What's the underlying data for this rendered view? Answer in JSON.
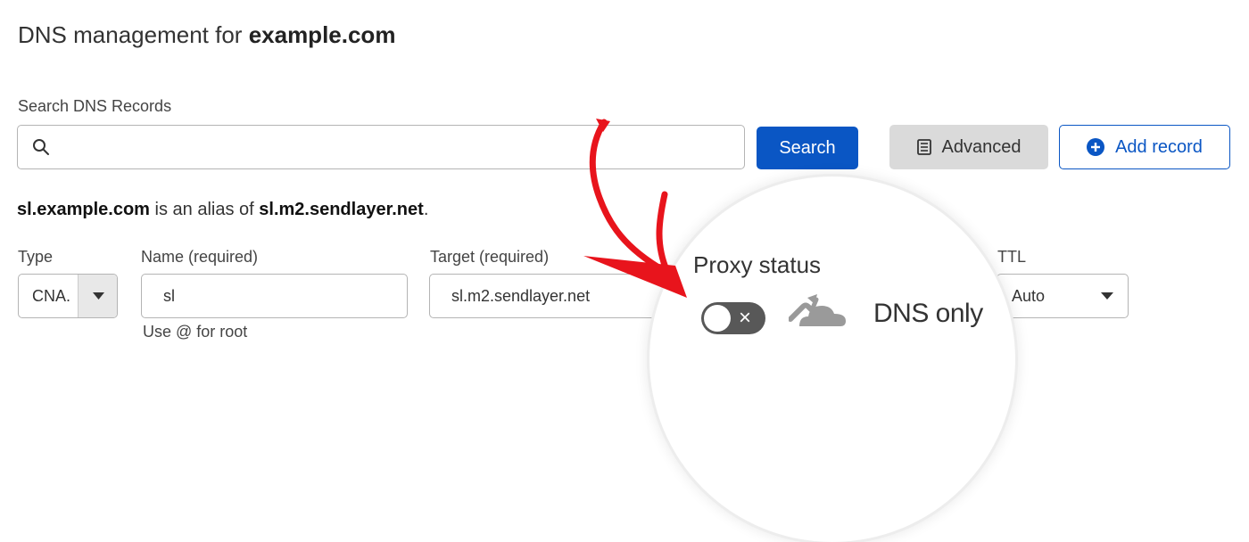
{
  "header": {
    "title_prefix": "DNS management for",
    "domain": "example.com"
  },
  "search": {
    "label": "Search DNS Records",
    "value": "",
    "placeholder": "",
    "button_label": "Search"
  },
  "toolbar": {
    "advanced_label": "Advanced",
    "add_record_label": "Add record"
  },
  "alias_note": {
    "host": "sl.example.com",
    "middle": "is an alias of",
    "target": "sl.m2.sendlayer.net",
    "end": "."
  },
  "record_form": {
    "type_label": "Type",
    "type_value": "CNA.",
    "name_label": "Name (required)",
    "name_value": "sl",
    "name_hint": "Use @ for root",
    "target_label": "Target (required)",
    "target_value": "sl.m2.sendlayer.net",
    "proxy_label": "Proxy status",
    "proxy_state": "DNS only",
    "proxy_enabled": false,
    "ttl_label": "TTL",
    "ttl_value": "Auto"
  },
  "colors": {
    "primary": "#0a56c4",
    "annotation_arrow": "#e8141c",
    "toggle_off": "#585858",
    "cloud_off": "#9a9a9a"
  },
  "icons": [
    "search-icon",
    "advanced-list-icon",
    "plus-circle-icon",
    "chevron-down-icon",
    "close-icon",
    "dns-only-cloud-icon",
    "annotation-arrow-icon"
  ]
}
